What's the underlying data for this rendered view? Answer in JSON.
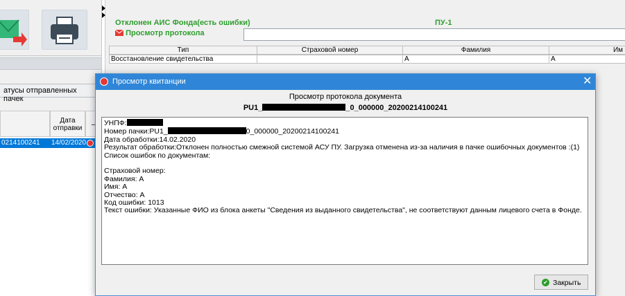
{
  "left": {
    "tab_label": "атусы отправленных пачек",
    "grid_header": {
      "col2_line1": "Дата",
      "col2_line2": "отправки",
      "col3": "–"
    },
    "row": {
      "id": "0214100241",
      "date": "14/02/2020"
    }
  },
  "top": {
    "status_text": "Отклонен АИС Фонда(есть ошибки)",
    "doc_type": "ПУ-1",
    "protocol_link": "Просмотр протокола",
    "table": {
      "headers": [
        "Тип",
        "Страховой номер",
        "Фамилия",
        "Им"
      ],
      "row": [
        "Восстановление свидетельства",
        "",
        "А",
        "А"
      ]
    }
  },
  "modal": {
    "title": "Просмотр квитанции",
    "heading": "Просмотр протокола документа",
    "filename_prefix": "PU1_",
    "filename_suffix": "_0_000000_20200214100241",
    "lines": {
      "unpf": "УНПФ:",
      "batch_prefix": "Номер пачки:PU1_",
      "batch_suffix": "0_000000_20200214100241",
      "date": "Дата обработки:14.02.2020",
      "result": "Результат обработки:Отклонен полностью смежной системой АСУ ПУ. Загрузка отменена из-за наличия в пачке ошибочных документов :(1)",
      "list": "Список ошибок по документам:",
      "ins": "Страховой номер:",
      "surname": "Фамилия: А",
      "name": "Имя: А",
      "patronymic": "Отчество: А",
      "code": "Код ошибки: 1013",
      "error": "Текст ошибки: Указанные ФИО из блока анкеты \"Сведения из выданного свидетельства\",  не соответствуют данным лицевого счета в Фонде."
    },
    "close_label": "Закрыть"
  },
  "colors": {
    "accent": "#2f86d8",
    "green": "#2e9e2e",
    "red": "#e53935",
    "selection": "#0078d7"
  }
}
